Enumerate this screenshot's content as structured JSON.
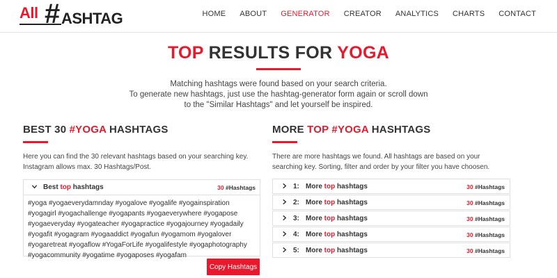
{
  "brand": {
    "logo_all": "All",
    "logo_hash": "#",
    "logo_tag": "ASHTAG"
  },
  "nav": {
    "items": [
      "HOME",
      "ABOUT",
      "GENERATOR",
      "CREATOR",
      "ANALYTICS",
      "CHARTS",
      "CONTACT"
    ],
    "active": "GENERATOR"
  },
  "title": {
    "prefix": "TOP",
    "middle": " RESULTS FOR ",
    "keyword": "YOGA"
  },
  "intro": {
    "line1": "Matching hashtags were found based on your search criteria.",
    "line2": "To generate new hashtags, just use the hashtag-generator form again or scroll down",
    "line3": "to the \"Similar Hashtags\" and let yourself be inspired."
  },
  "best": {
    "heading_prefix": "BEST 30 ",
    "heading_keyword": "#YOGA",
    "heading_suffix": " HASHTAGS",
    "description": "Here you can find the 30 relevant hashtags based on your searching key. Instagram allows max. 30 Hashtags/Post.",
    "panel_label_prefix": "Best ",
    "panel_label_red": "top",
    "panel_label_suffix": " hashtags",
    "count_num": "30",
    "count_label": " #Hashtags",
    "hashtags": "#yoga #yogaeverydamnday #yogalove #yogalife #yogainspiration #yogagirl #yogachallenge #yogapants #yogaeverywhere #yogapose #yogaeveryday #yogateacher #yogapractice #yogajourney #yogadaily #yogafit #yogagram #yogaaddict #yogafun #yogamom #yogalover #yogaretreat #yogaflow #YogaForLife #yogalifestyle #yogaphotography #yogacommunity #yogatime #yogaposes #yogafam",
    "copy_button": "Copy Hashtags"
  },
  "more": {
    "heading_prefix": "MORE ",
    "heading_red": "TOP #YOGA",
    "heading_suffix": " HASHTAGS",
    "description": "There are more hashtags we found. All hashtags are based on your searching key. Sorting, filter and order by your filter you have choosen.",
    "items": [
      {
        "index": "1:",
        "prefix": "More ",
        "red": "top",
        "suffix": " hashtags",
        "count_num": "30",
        "count_label": " #Hashtags"
      },
      {
        "index": "2:",
        "prefix": "More ",
        "red": "top",
        "suffix": " hashtags",
        "count_num": "30",
        "count_label": " #Hashtags"
      },
      {
        "index": "3:",
        "prefix": "More ",
        "red": "top",
        "suffix": " hashtags",
        "count_num": "30",
        "count_label": " #Hashtags"
      },
      {
        "index": "4:",
        "prefix": "More ",
        "red": "top",
        "suffix": " hashtags",
        "count_num": "30",
        "count_label": " #Hashtags"
      },
      {
        "index": "5:",
        "prefix": "More ",
        "red": "top",
        "suffix": " hashtags",
        "count_num": "30",
        "count_label": " #Hashtags"
      }
    ]
  },
  "icons": {
    "expanded": "chevron-down-icon",
    "collapsed": "chevron-right-icon"
  },
  "colors": {
    "accent": "#e8192c",
    "text": "#333333",
    "border": "#e0e0e0"
  }
}
